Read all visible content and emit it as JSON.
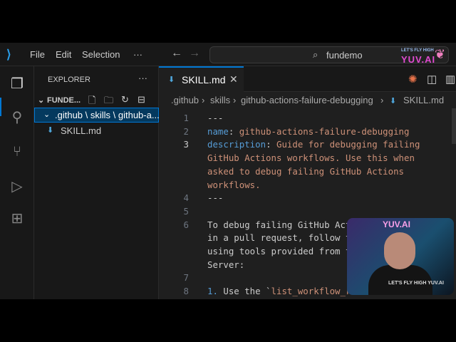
{
  "titlebar": {
    "menu": [
      "File",
      "Edit",
      "Selection",
      "···"
    ],
    "search_text": "fundemo"
  },
  "brand": {
    "tagline": "LET'S FLY HIGH",
    "name": "YUV.AI"
  },
  "sidebar": {
    "title": "EXPLORER",
    "more": "···",
    "folder": "FUNDE...",
    "selected_path": ".github \\ skills \\ github-a...",
    "file": "SKILL.md"
  },
  "tab": {
    "label": "SKILL.md",
    "close": "✕"
  },
  "breadcrumb": [
    ".github",
    "skills",
    "github-actions-failure-debugging",
    "SKILL.md"
  ],
  "editor": {
    "lines": [
      {
        "n": "1",
        "t": "---"
      },
      {
        "n": "2",
        "k": "name",
        "v": "github-actions-failure-debugging"
      },
      {
        "n": "3",
        "k": "description",
        "v": "Guide for debugging failing"
      },
      {
        "n": "",
        "v2": "GitHub Actions workflows. Use this when"
      },
      {
        "n": "",
        "v2": "asked to debug failing GitHub Actions"
      },
      {
        "n": "",
        "v2": "workflows."
      },
      {
        "n": "4",
        "t": "---"
      },
      {
        "n": "5",
        "t": ""
      },
      {
        "n": "6",
        "t": "To debug failing GitHub Actions workflows"
      },
      {
        "n": "",
        "t": "in a pull request, follow these steps,"
      },
      {
        "n": "",
        "t": "using tools provided from the GitHub MCP"
      },
      {
        "n": "",
        "t": "Server:"
      },
      {
        "n": "7",
        "t": ""
      },
      {
        "n": "8",
        "num": "1.",
        "t": " Use the `",
        "code": "list_workflow_runs`"
      }
    ]
  },
  "webcam": {
    "sign": "YUV.AI",
    "shirt": "LET'S FLY HIGH YUV.AI"
  }
}
